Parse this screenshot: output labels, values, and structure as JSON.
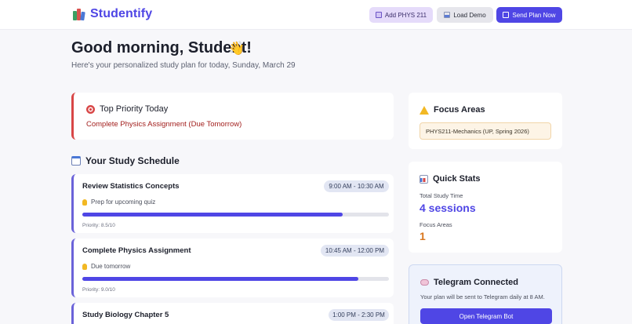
{
  "app": {
    "name": "Studentify"
  },
  "header": {
    "add_label": "Add PHYS 211",
    "demo_label": "Load Demo",
    "send_label": "Send Plan Now"
  },
  "greeting": {
    "title": "Good morning, Student!",
    "emoji": "👋",
    "subtitle": "Here's your personalized study plan for today, Sunday, March 29"
  },
  "priority": {
    "heading": "Top Priority Today",
    "task": "Complete Physics Assignment (Due Tomorrow)"
  },
  "schedule": {
    "heading": "Your Study Schedule",
    "tasks": [
      {
        "name": "Review Statistics Concepts",
        "time": "9:00 AM - 10:30 AM",
        "note": "Prep for upcoming quiz",
        "progress": 0.85,
        "priority": "Priority: 8.5/10"
      },
      {
        "name": "Complete Physics Assignment",
        "time": "10:45 AM - 12:00 PM",
        "note": "Due tomorrow",
        "progress": 0.9,
        "priority": "Priority: 9.0/10"
      },
      {
        "name": "Study Biology Chapter 5",
        "time": "1:00 PM - 2:30 PM"
      }
    ]
  },
  "focus_areas": {
    "heading": "Focus Areas",
    "items": [
      "PHYS211-Mechanics (UP, Spring 2026)"
    ]
  },
  "quick_stats": {
    "heading": "Quick Stats",
    "study_time_label": "Total Study Time",
    "study_time_value": "4 sessions",
    "focus_label": "Focus Areas",
    "focus_value": "1"
  },
  "telegram": {
    "heading": "Telegram Connected",
    "text": "Your plan will be sent to Telegram daily at 8 AM.",
    "button_label": "Open Telegram Bot"
  },
  "colors": {
    "brand": "#4f46e5",
    "priority_accent": "#d84646",
    "stat_primary": "#4f46e5",
    "stat_secondary": "#d9771f"
  }
}
